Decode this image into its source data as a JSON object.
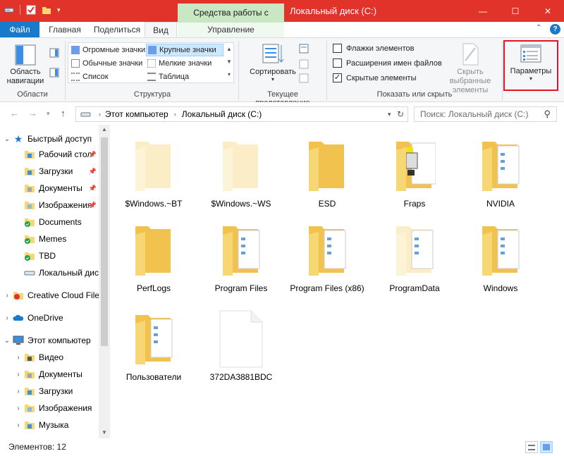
{
  "titlebar": {
    "context_tab": "Средства работы с дисками",
    "title": "Локальный диск (C:)",
    "minimize": "—",
    "maximize": "☐",
    "close": "✕"
  },
  "tabs": {
    "file": "Файл",
    "home": "Главная",
    "share": "Поделиться",
    "view": "Вид",
    "manage": "Управление"
  },
  "ribbon": {
    "panes": {
      "nav_pane_label": "Область навигации",
      "group_label": "Области"
    },
    "layout": {
      "items": [
        "Огромные значки",
        "Крупные значки",
        "Обычные значки",
        "Мелкие значки",
        "Список",
        "Таблица"
      ],
      "selected": "Крупные значки",
      "group_label": "Структура"
    },
    "current_view": {
      "sort_label": "Сортировать",
      "group_label": "Текущее представление"
    },
    "show_hide": {
      "checkboxes": [
        {
          "label": "Флажки элементов",
          "checked": false
        },
        {
          "label": "Расширения имен файлов",
          "checked": false
        },
        {
          "label": "Скрытые элементы",
          "checked": true
        }
      ],
      "hide_selected_line1": "Скрыть выбранные",
      "hide_selected_line2": "элементы",
      "group_label": "Показать или скрыть"
    },
    "options_label": "Параметры"
  },
  "address": {
    "path": [
      "Этот компьютер",
      "Локальный диск (C:)"
    ],
    "search_placeholder": "Поиск: Локальный диск (C:)"
  },
  "navpane": {
    "items": [
      {
        "label": "Быстрый доступ",
        "level": 0,
        "expanded": true,
        "icon": "star-icon"
      },
      {
        "label": "Рабочий стол",
        "level": 1,
        "pinned": true,
        "icon": "desktop-icon"
      },
      {
        "label": "Загрузки",
        "level": 1,
        "pinned": true,
        "icon": "downloads-icon"
      },
      {
        "label": "Документы",
        "level": 1,
        "pinned": true,
        "icon": "documents-icon"
      },
      {
        "label": "Изображения",
        "level": 1,
        "pinned": true,
        "icon": "pictures-icon"
      },
      {
        "label": "Documents",
        "level": 1,
        "icon": "synced-folder-icon"
      },
      {
        "label": "Memes",
        "level": 1,
        "icon": "synced-folder-icon"
      },
      {
        "label": "TBD",
        "level": 1,
        "icon": "synced-folder-icon"
      },
      {
        "label": "Локальный диск",
        "level": 1,
        "icon": "drive-icon"
      },
      {
        "label": "Creative Cloud File",
        "level": 0,
        "expanded": false,
        "icon": "creative-cloud-icon"
      },
      {
        "label": "OneDrive",
        "level": 0,
        "expanded": false,
        "icon": "onedrive-icon"
      },
      {
        "label": "Этот компьютер",
        "level": 0,
        "expanded": true,
        "icon": "computer-icon"
      },
      {
        "label": "Видео",
        "level": 1,
        "expanded": false,
        "icon": "videos-icon"
      },
      {
        "label": "Документы",
        "level": 1,
        "expanded": false,
        "icon": "documents-icon"
      },
      {
        "label": "Загрузки",
        "level": 1,
        "expanded": false,
        "icon": "downloads-icon"
      },
      {
        "label": "Изображения",
        "level": 1,
        "expanded": false,
        "icon": "pictures-icon"
      },
      {
        "label": "Музыка",
        "level": 1,
        "expanded": false,
        "icon": "music-icon"
      }
    ]
  },
  "files": [
    {
      "name": "$Windows.~BT",
      "kind": "folder-faded"
    },
    {
      "name": "$Windows.~WS",
      "kind": "folder-faded"
    },
    {
      "name": "ESD",
      "kind": "folder"
    },
    {
      "name": "Fraps",
      "kind": "folder-fraps"
    },
    {
      "name": "NVIDIA",
      "kind": "folder-docs"
    },
    {
      "name": "PerfLogs",
      "kind": "folder"
    },
    {
      "name": "Program Files",
      "kind": "folder-docs"
    },
    {
      "name": "Program Files (x86)",
      "kind": "folder-docs"
    },
    {
      "name": "ProgramData",
      "kind": "folder-faded-docs"
    },
    {
      "name": "Windows",
      "kind": "folder-docs"
    },
    {
      "name": "Пользователи",
      "kind": "folder-docs"
    },
    {
      "name": "372DA3881BDC",
      "kind": "file"
    }
  ],
  "status": {
    "items_count": "Элементов: 12"
  },
  "colors": {
    "titlebar": "#e2332b",
    "file_tab": "#1979ca",
    "context_tab": "#c8e7c2",
    "highlight": "#e81123",
    "folder": "#f7d774"
  }
}
